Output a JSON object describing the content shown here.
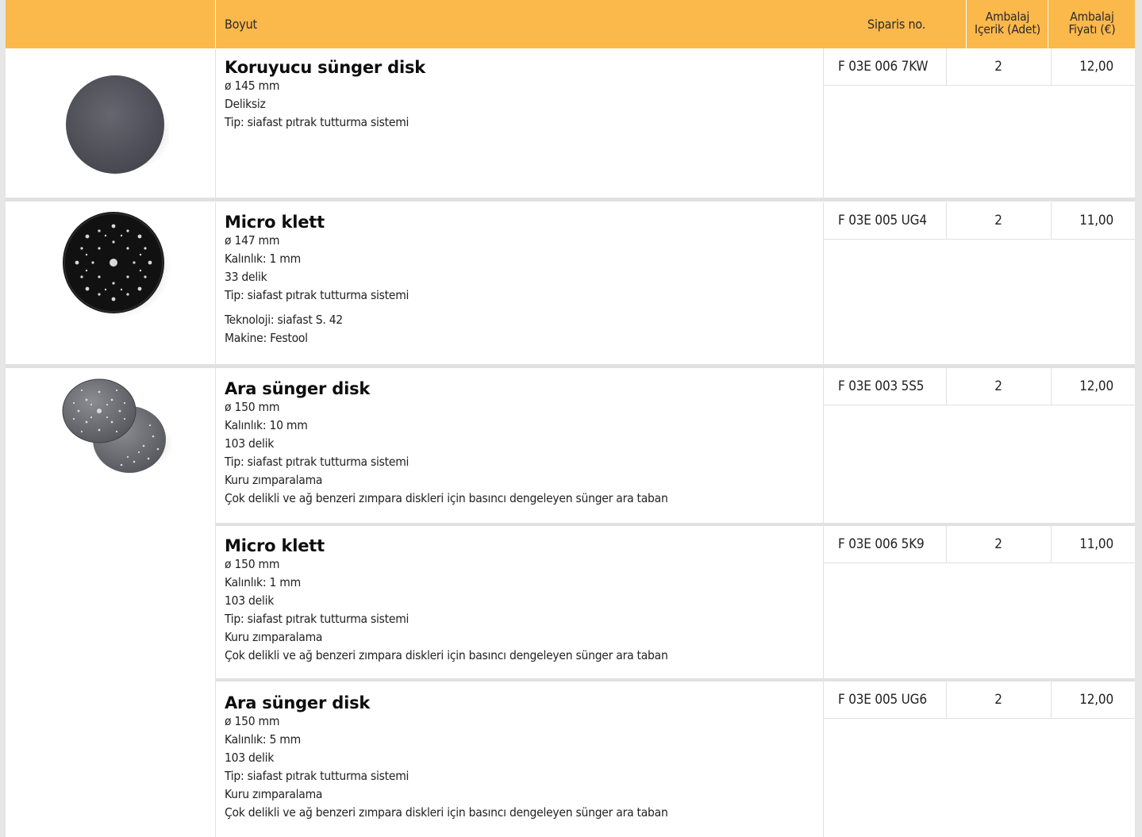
{
  "header": {
    "col_size": "Boyut",
    "col_order": "Siparis no.",
    "col_pack_qty_l1": "Ambalaj",
    "col_pack_qty_l2": "Içerik (Adet)",
    "col_pack_price_l1": "Ambalaj",
    "col_pack_price_l2": "Fiyatı (€)"
  },
  "colors": {
    "header_bg": "#fbb84b",
    "separator": "#e1e1e1",
    "frame": "#e6e6e6"
  },
  "products": [
    {
      "name": "Koruyucu sünger disk",
      "lines": [
        "ø 145 mm",
        "Deliksiz",
        "Tip: siafast pıtrak tutturma sistemi"
      ],
      "extra": [],
      "order_no": "F 03E 006 7KW",
      "qty": "2",
      "price": "12,00",
      "image": "plain-grey-disc-image"
    },
    {
      "name": "Micro klett",
      "lines": [
        "ø 147 mm",
        "Kalınlık: 1 mm",
        "33 delik",
        "Tip: siafast pıtrak tutturma sistemi"
      ],
      "extra": [
        "Teknoloji: siafast S. 42",
        "Makine: Festool"
      ],
      "order_no": "F 03E 005 UG4",
      "qty": "2",
      "price": "11,00",
      "image": "black-perforated-disc-image"
    },
    {
      "name": "Ara sünger disk",
      "lines": [
        "ø 150 mm",
        "Kalınlık: 10 mm",
        "103 delik",
        "Tip: siafast pıtrak tutturma sistemi",
        "Kuru zımparalama",
        "Çok delikli ve ağ benzeri zımpara diskleri için basıncı dengeleyen sünger ara taban"
      ],
      "extra": [],
      "order_no": "F 03E 003 5S5",
      "qty": "2",
      "price": "12,00",
      "image": "two-perforated-discs-image"
    },
    {
      "name": "Micro klett",
      "lines": [
        "ø 150 mm",
        "Kalınlık: 1 mm",
        "103 delik",
        "Tip: siafast pıtrak tutturma sistemi",
        "Kuru zımparalama",
        "Çok delikli ve ağ benzeri zımpara diskleri için basıncı dengeleyen sünger ara taban"
      ],
      "extra": [],
      "order_no": "F 03E 006 5K9",
      "qty": "2",
      "price": "11,00"
    },
    {
      "name": "Ara sünger disk",
      "lines": [
        "ø 150 mm",
        "Kalınlık: 5 mm",
        "103 delik",
        "Tip: siafast pıtrak tutturma sistemi",
        "Kuru zımparalama",
        "Çok delikli ve ağ benzeri zımpara diskleri için basıncı dengeleyen sünger ara taban"
      ],
      "extra": [],
      "order_no": "F 03E 005 UG6",
      "qty": "2",
      "price": "12,00"
    }
  ]
}
